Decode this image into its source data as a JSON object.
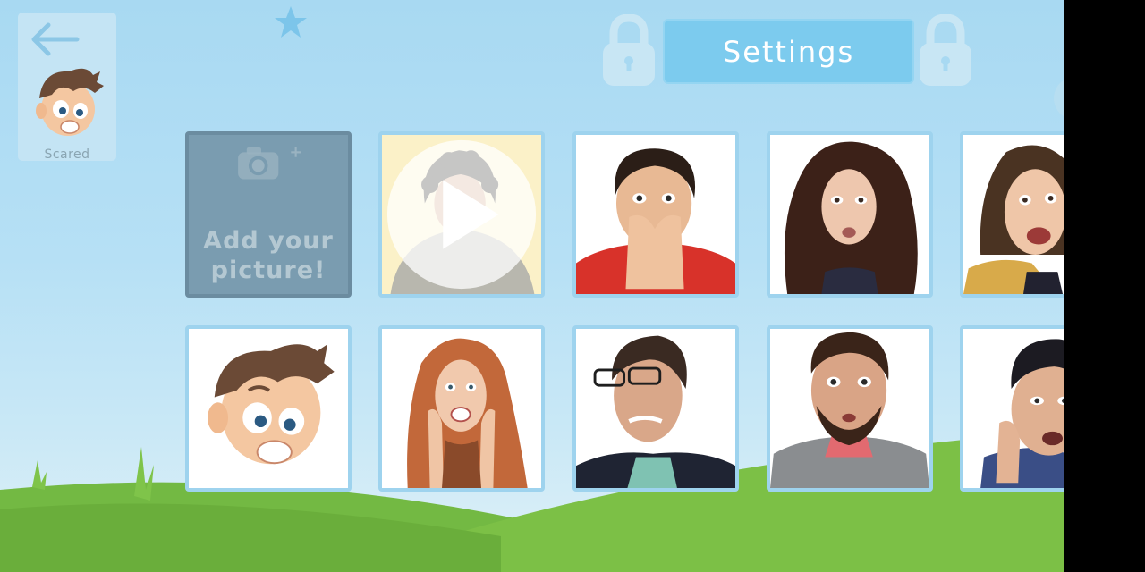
{
  "header": {
    "title": "Settings"
  },
  "back": {
    "label": "Scared",
    "icon": "back-arrow-icon"
  },
  "add_tile": {
    "label_line1": "Add your",
    "label_line2": "picture!",
    "icon": "camera-plus-icon"
  },
  "colors": {
    "sky": "#a8d9f2",
    "title_button": "#7ccbee",
    "tile_border": "#9ed3ee",
    "grass": "#6fb83c"
  },
  "tiles": [
    {
      "subject": "scared-boy-video",
      "has_play": true
    },
    {
      "subject": "scared-boy-hands"
    },
    {
      "subject": "scared-woman-curly"
    },
    {
      "subject": "scared-woman-yellow"
    },
    {
      "subject": "scared-cartoon-boy"
    },
    {
      "subject": "scared-redhead-woman"
    },
    {
      "subject": "scared-man-glasses"
    },
    {
      "subject": "scared-bearded-man"
    },
    {
      "subject": "scared-man-dark-hair"
    }
  ]
}
